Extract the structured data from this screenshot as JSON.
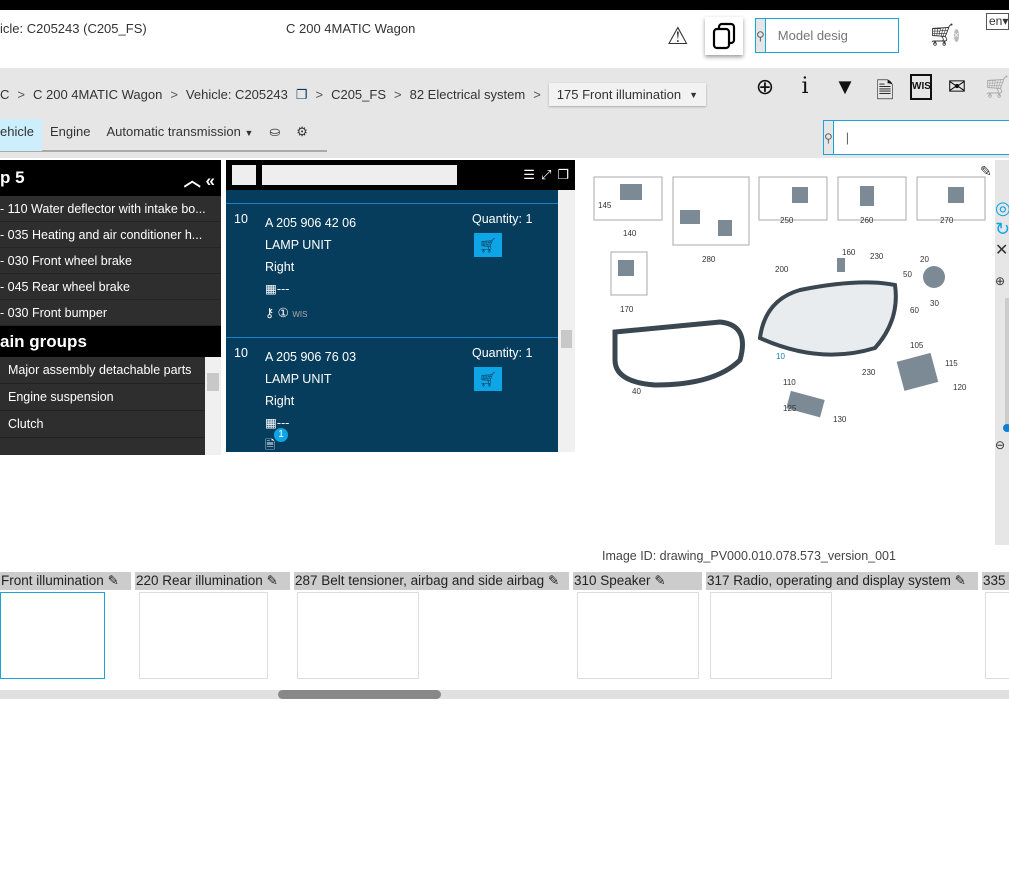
{
  "header": {
    "vehicle_label": "icle: C205243 (C205_FS)",
    "model": "C 200 4MATIC Wagon",
    "search_placeholder": "Model desig",
    "language": "en"
  },
  "breadcrumb": {
    "items": [
      "C",
      "C 200 4MATIC Wagon",
      "Vehicle: C205243",
      "C205_FS",
      "82 Electrical system"
    ],
    "current": "175 Front illumination",
    "sep": ">"
  },
  "tabs": [
    "ehicle",
    "Engine",
    "Automatic transmission"
  ],
  "toolbar_icons": [
    "zoom-in-icon",
    "info-icon",
    "filter-icon",
    "document-alert-icon",
    "wis-icon",
    "mail-edit-icon",
    "cart-list-icon"
  ],
  "left_panel": {
    "title": "p 5",
    "recent": [
      "- 110 Water deflector with intake bo...",
      "- 035 Heating and air conditioner h...",
      "- 030 Front wheel brake",
      "- 045 Rear wheel brake",
      "- 030 Front bumper"
    ],
    "main_groups_title": "ain groups",
    "main_groups": [
      "Major assembly detachable parts",
      "Engine suspension",
      "Clutch"
    ]
  },
  "parts": [
    {
      "pos": "10",
      "number": "A 205 906 42 06",
      "name": "LAMP UNIT",
      "side": "Right",
      "code": "---",
      "quantity": "Quantity: 1"
    },
    {
      "pos": "10",
      "number": "A 205 906 76 03",
      "name": "LAMP UNIT",
      "side": "Right",
      "code": "---",
      "quantity": "Quantity: 1",
      "badge": "1"
    }
  ],
  "diagram": {
    "callouts": [
      "145",
      "140",
      "280",
      "250",
      "260",
      "270",
      "170",
      "200",
      "160",
      "230",
      "20",
      "50",
      "30",
      "60",
      "10",
      "40",
      "105",
      "115",
      "120",
      "110",
      "230",
      "125",
      "130"
    ],
    "image_id": "Image ID: drawing_PV000.010.078.573_version_001"
  },
  "strip": [
    "Front illumination",
    "220 Rear illumination",
    "287 Belt tensioner, airbag and side airbag",
    "310 Speaker",
    "317 Radio, operating and display system",
    "335"
  ],
  "colors": {
    "accent": "#0ea5e6",
    "panel": "#073d5c",
    "dark": "#2e2e2e"
  }
}
